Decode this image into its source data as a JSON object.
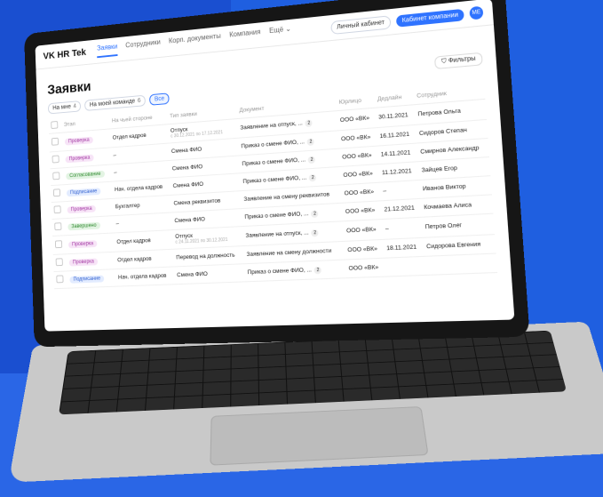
{
  "app": {
    "brand": "VK HR Tek",
    "nav": [
      {
        "label": "Заявки",
        "active": true
      },
      {
        "label": "Сотрудники",
        "active": false
      },
      {
        "label": "Корп. документы",
        "active": false
      },
      {
        "label": "Компания",
        "active": false
      },
      {
        "label": "Ещё",
        "active": false
      }
    ],
    "personal_cabinet": "Личный кабинет",
    "company_cabinet": "Кабинет компании",
    "avatar_initials": "МЕ"
  },
  "page": {
    "title": "Заявки",
    "filters_label": "Фильтры",
    "chips": [
      {
        "label": "На мне",
        "count": "4"
      },
      {
        "label": "На моей команде",
        "count": "6"
      },
      {
        "label": "Все",
        "count": ""
      }
    ]
  },
  "table": {
    "headers": [
      "Этап",
      "На чьей стороне",
      "Тип заявки",
      "Документ",
      "Юрлицо",
      "Дедлайн",
      "Сотрудник"
    ],
    "rows": [
      {
        "stage": "Проверка",
        "stage_type": "check",
        "side": "Отдел кадров",
        "type": "Отпуск",
        "type_sub": "с 30.12.2021 по 17.12.2021",
        "doc": "Заявление на отпуск, ...",
        "doc_num": "2",
        "entity": "ООО «ВК»",
        "deadline": "30.11.2021",
        "employee": "Петрова Ольга"
      },
      {
        "stage": "Проверка",
        "stage_type": "check",
        "side": "–",
        "type": "Смена ФИО",
        "type_sub": "",
        "doc": "Приказ о смене ФИО, ...",
        "doc_num": "2",
        "entity": "ООО «ВК»",
        "deadline": "16.11.2021",
        "employee": "Сидоров Степан"
      },
      {
        "stage": "Согласование",
        "stage_type": "agree",
        "side": "–",
        "type": "Смена ФИО",
        "type_sub": "",
        "doc": "Приказ о смене ФИО, ...",
        "doc_num": "2",
        "entity": "ООО «ВК»",
        "deadline": "14.11.2021",
        "employee": "Смирнов Александр"
      },
      {
        "stage": "Подписание",
        "stage_type": "sign",
        "side": "Нач. отдела кадров",
        "type": "Смена ФИО",
        "type_sub": "",
        "doc": "Приказ о смене ФИО, ...",
        "doc_num": "2",
        "entity": "ООО «ВК»",
        "deadline": "11.12.2021",
        "employee": "Зайцев Егор"
      },
      {
        "stage": "Проверка",
        "stage_type": "check",
        "side": "Бухгалтер",
        "type": "Смена реквизитов",
        "type_sub": "",
        "doc": "Заявление на смену реквизитов",
        "doc_num": "",
        "entity": "ООО «ВК»",
        "deadline": "–",
        "employee": "Иванов Виктор"
      },
      {
        "stage": "Завершено",
        "stage_type": "agree",
        "side": "–",
        "type": "Смена ФИО",
        "type_sub": "",
        "doc": "Приказ о смене ФИО, ...",
        "doc_num": "2",
        "entity": "ООО «ВК»",
        "deadline": "21.12.2021",
        "employee": "Кочмаева Алиса"
      },
      {
        "stage": "Проверка",
        "stage_type": "check",
        "side": "Отдел кадров",
        "type": "Отпуск",
        "type_sub": "с 24.11.2021 по 30.12.2021",
        "doc": "Заявление на отпуск, ...",
        "doc_num": "2",
        "entity": "ООО «ВК»",
        "deadline": "–",
        "employee": "Петров Олег"
      },
      {
        "stage": "Проверка",
        "stage_type": "check",
        "side": "Отдел кадров",
        "type": "Перевод на должность",
        "type_sub": "",
        "doc": "Заявление на смену должности",
        "doc_num": "",
        "entity": "ООО «ВК»",
        "deadline": "18.11.2021",
        "employee": "Сидорова Евгения"
      },
      {
        "stage": "Подписание",
        "stage_type": "sign",
        "side": "Нач. отдела кадров",
        "type": "Смена ФИО",
        "type_sub": "",
        "doc": "Приказ о смене ФИО, ...",
        "doc_num": "2",
        "entity": "ООО «ВК»",
        "deadline": "",
        "employee": ""
      }
    ]
  }
}
